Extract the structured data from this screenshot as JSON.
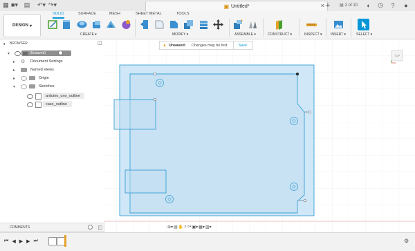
{
  "window": {
    "title": "Untitled*",
    "close_glyph": "×",
    "plus_glyph": "+",
    "version_label": "2 of 10"
  },
  "toolbar": {
    "design_label": "DESIGN",
    "tabs": [
      "SOLID",
      "SURFACE",
      "MESH",
      "SHEET METAL",
      "TOOLS"
    ],
    "active_tab": "SOLID",
    "groups": {
      "create": "CREATE",
      "modify": "MODIFY",
      "assemble": "ASSEMBLE",
      "construct": "CONSTRUCT",
      "inspect": "INSPECT",
      "insert": "INSERT",
      "select": "SELECT"
    }
  },
  "browser": {
    "title": "BROWSER",
    "root": "(Unsaved)",
    "items": [
      {
        "label": "Document Settings"
      },
      {
        "label": "Named Views"
      },
      {
        "label": "Origin"
      },
      {
        "label": "Sketches"
      }
    ],
    "sketches": [
      "arduino_uno_outline",
      "case_outline"
    ]
  },
  "notice": {
    "status": "Unsaved:",
    "message": "Changes may be lost",
    "action": "Save"
  },
  "viewcube": {
    "label": "TOP"
  },
  "comments": {
    "title": "COMMENTS"
  },
  "colors": {
    "accent": "#0696d7",
    "sketch_fill": "#cfe7f6",
    "sketch_stroke": "#3aa0d6",
    "outline_stroke": "#5a6a7a",
    "grid": "#e6eef3"
  },
  "icons": {
    "viewcube": "viewcube-icon",
    "timeline": "timeline-marker-icon",
    "settings": "gear-icon"
  }
}
